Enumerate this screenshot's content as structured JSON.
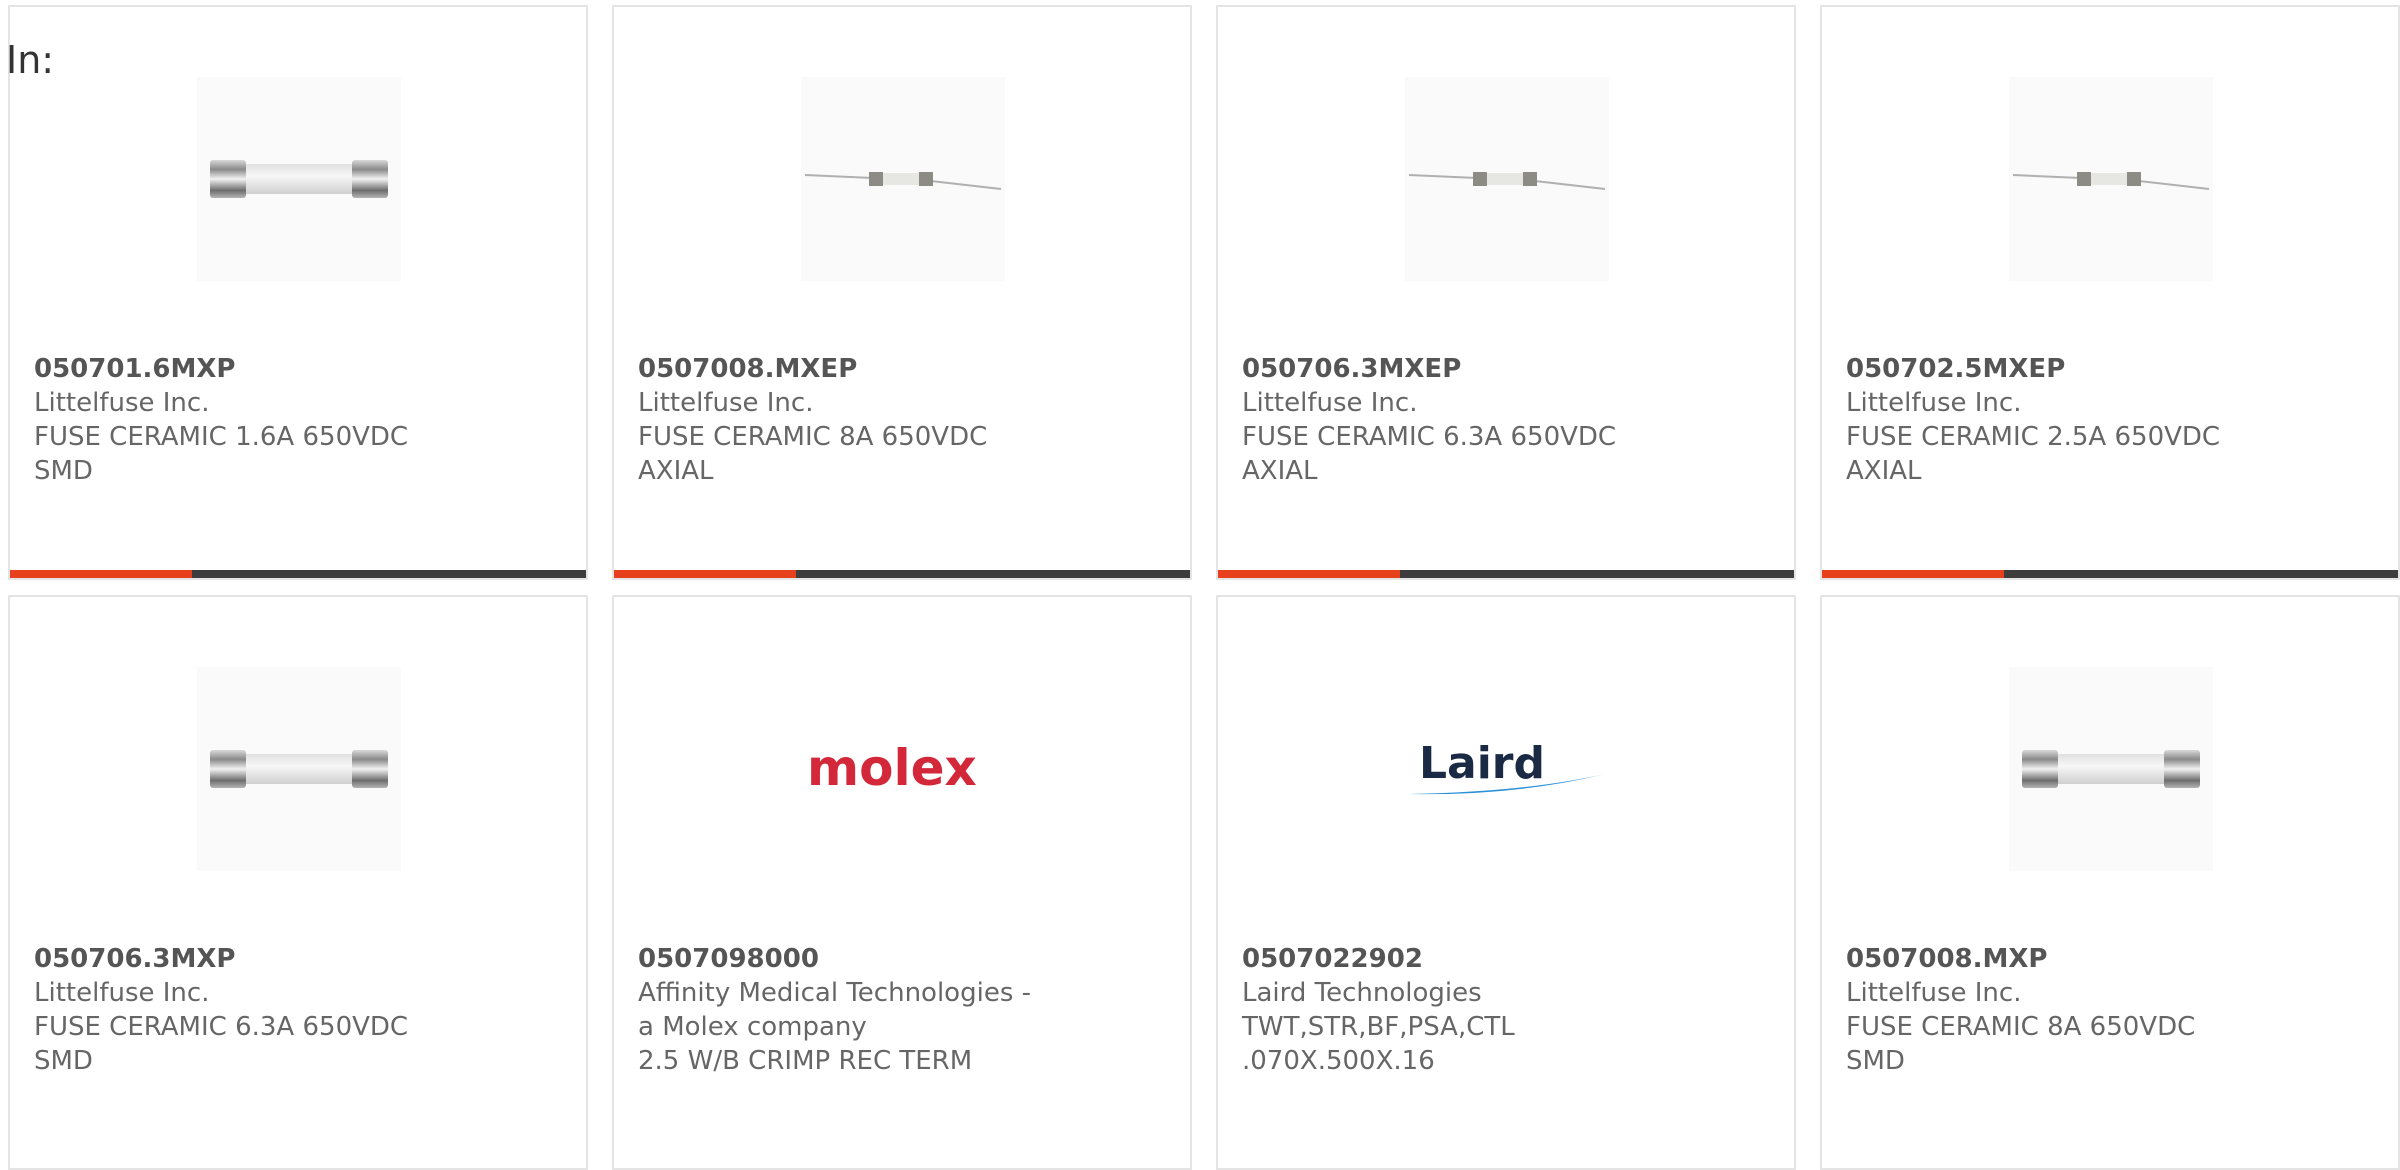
{
  "header": {
    "in_label": "In:"
  },
  "colors": {
    "accent_bar": "#e8401c",
    "dark_bar": "#3d3d3d",
    "card_border": "#e4e4e4"
  },
  "products": [
    {
      "part": "050701.6MXP",
      "manufacturer": "Littelfuse Inc.",
      "description": "FUSE CERAMIC 1.6A 650VDC SMD",
      "image": "cartridge-fuse-icon"
    },
    {
      "part": "0507008.MXEP",
      "manufacturer": "Littelfuse Inc.",
      "description": "FUSE CERAMIC 8A 650VDC AXIAL",
      "image": "axial-fuse-icon"
    },
    {
      "part": "050706.3MXEP",
      "manufacturer": "Littelfuse Inc.",
      "description": "FUSE CERAMIC 6.3A 650VDC AXIAL",
      "image": "axial-fuse-icon"
    },
    {
      "part": "050702.5MXEP",
      "manufacturer": "Littelfuse Inc.",
      "description": "FUSE CERAMIC 2.5A 650VDC AXIAL",
      "image": "axial-fuse-icon"
    },
    {
      "part": "050706.3MXP",
      "manufacturer": "Littelfuse Inc.",
      "description": "FUSE CERAMIC 6.3A 650VDC SMD",
      "image": "cartridge-fuse-icon"
    },
    {
      "part": "0507098000",
      "manufacturer": "Affinity Medical Technologies - a Molex company",
      "description": "2.5 W/B CRIMP REC TERM",
      "image": "molex-logo",
      "logo_text": "molex"
    },
    {
      "part": "0507022902",
      "manufacturer": "Laird Technologies",
      "description": "TWT,STR,BF,PSA,CTL .070X.500X.16",
      "image": "laird-logo",
      "logo_text": "Laird"
    },
    {
      "part": "0507008.MXP",
      "manufacturer": "Littelfuse Inc.",
      "description": "FUSE CERAMIC 8A 650VDC SMD",
      "image": "cartridge-fuse-icon"
    }
  ]
}
